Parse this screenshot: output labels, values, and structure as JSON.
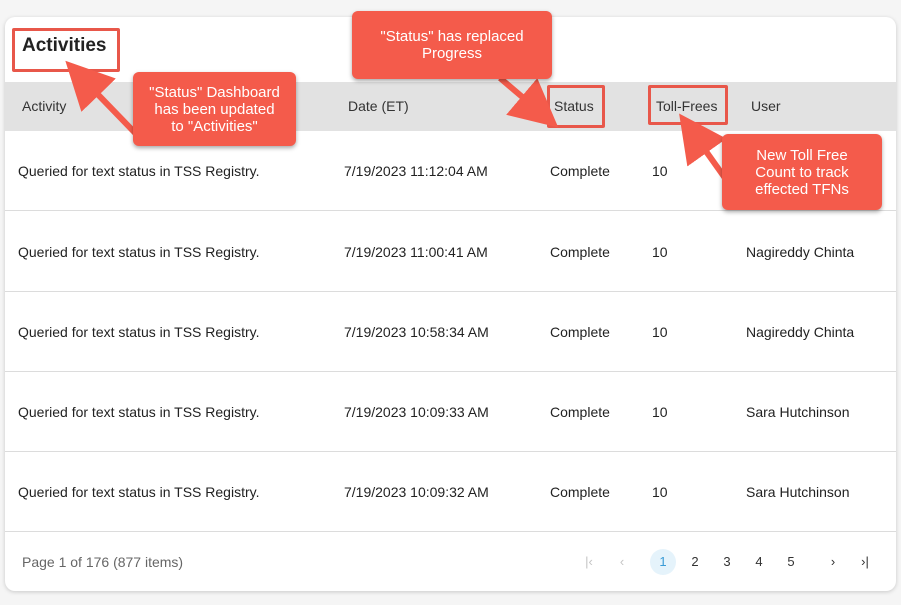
{
  "card": {
    "title": "Activities"
  },
  "table": {
    "headers": {
      "activity": "Activity",
      "date": "Date (ET)",
      "status": "Status",
      "toll_frees": "Toll-Frees",
      "user": "User"
    },
    "rows": [
      {
        "activity": "Queried for text status in TSS Registry.",
        "date": "7/19/2023 11:12:04 AM",
        "status": "Complete",
        "toll_frees": "10",
        "user": ""
      },
      {
        "activity": "Queried for text status in TSS Registry.",
        "date": "7/19/2023 11:00:41 AM",
        "status": "Complete",
        "toll_frees": "10",
        "user": "Nagireddy Chinta"
      },
      {
        "activity": "Queried for text status in TSS Registry.",
        "date": "7/19/2023 10:58:34 AM",
        "status": "Complete",
        "toll_frees": "10",
        "user": "Nagireddy Chinta"
      },
      {
        "activity": "Queried for text status in TSS Registry.",
        "date": "7/19/2023 10:09:33 AM",
        "status": "Complete",
        "toll_frees": "10",
        "user": "Sara Hutchinson"
      },
      {
        "activity": "Queried for text status in TSS Registry.",
        "date": "7/19/2023 10:09:32 AM",
        "status": "Complete",
        "toll_frees": "10",
        "user": "Sara Hutchinson"
      }
    ]
  },
  "footer": {
    "page_info": "Page 1 of 176 (877 items)",
    "pager": {
      "first": "|‹",
      "prev": "‹",
      "pages": [
        "1",
        "2",
        "3",
        "4",
        "5"
      ],
      "next": "›",
      "last": "›|"
    }
  },
  "annotations": {
    "activities_note": "\"Status\" Dashboard\nhas been updated\nto \"Activities\"",
    "status_note": "\"Status\" has replaced\nProgress",
    "toll_note": "New Toll Free\nCount to track\neffected TFNs"
  },
  "colors": {
    "annotation": "#f45b4b",
    "active_page_bg": "#e5f3fb",
    "header_bg": "#e2e2e2"
  }
}
